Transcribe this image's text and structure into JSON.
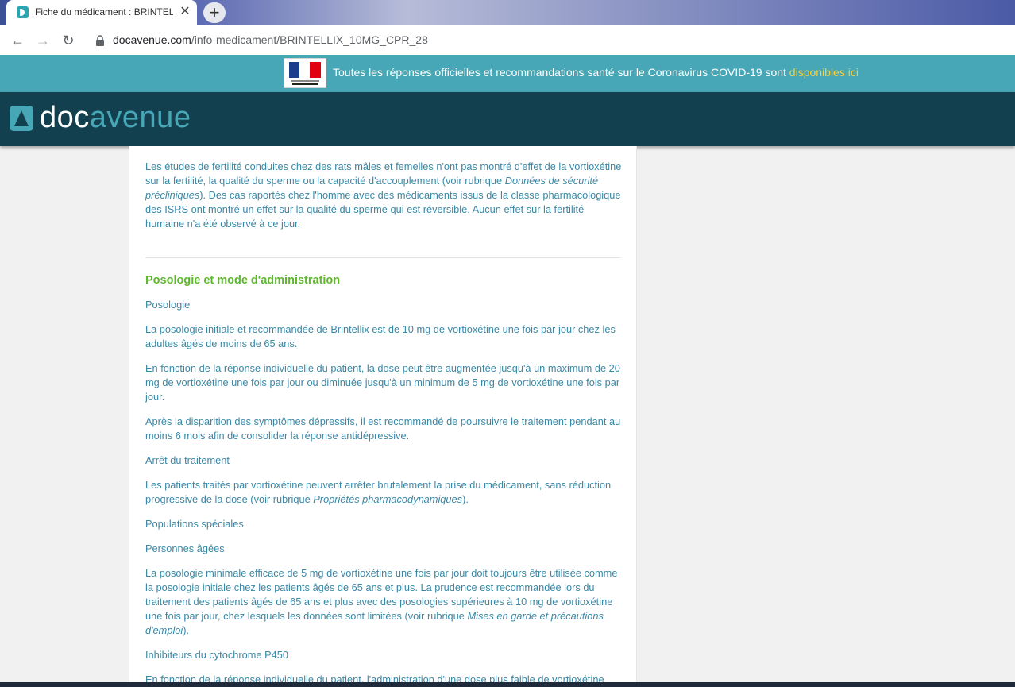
{
  "browser": {
    "tab_title": "Fiche du médicament : BRINTELLIX",
    "tab_close_glyph": "✕",
    "new_tab_glyph": "+",
    "back_glyph": "←",
    "forward_glyph": "→",
    "reload_glyph": "↻",
    "url_host": "docavenue.com",
    "url_path": "/info-medicament/BRINTELLIX_10MG_CPR_28"
  },
  "banner": {
    "text": "Toutes les réponses officielles et recommandations santé sur le Coronavirus COVID-19 sont ",
    "link": "disponibles ici",
    "text_color": "#ffffff",
    "link_color": "#f4d03f",
    "background": "#48a7b6"
  },
  "site": {
    "logo_part1": "doc",
    "logo_part2": "avenue",
    "header_background": "#12404e"
  },
  "content": {
    "fertility_1": "Les études de fertilité conduites chez des rats mâles et femelles n'ont pas montré d'effet de la vortioxétine sur la fertilité, la qualité du sperme ou la capacité d'accouplement (voir rubrique ",
    "fertility_em": "Données de sécurité précliniques",
    "fertility_2": "). Des cas raportés chez l'homme avec des médicaments issus de la classe pharmacologique des ISRS ont montré un effet sur la qualité du sperme qui est réversible. Aucun effet sur la fertilité humaine n'a été observé à ce jour.",
    "section_title": "Posologie et mode d'administration",
    "posologie_label": "Posologie",
    "p1": "La posologie initiale et recommandée de Brintellix est de 10 mg de vortioxétine une fois par jour chez les adultes âgés de moins de 65 ans.",
    "p2": "En fonction de la réponse individuelle du patient, la dose peut être augmentée jusqu'à un maximum de 20 mg de vortioxétine une fois par jour ou diminuée jusqu'à un minimum de 5 mg de vortioxétine une fois par jour.",
    "p3": "Après la disparition des symptômes dépressifs, il est recommandé de poursuivre le traitement pendant au moins 6 mois afin de consolider la réponse antidépressive.",
    "arret_label": "Arrêt du traitement",
    "p4_1": "Les patients traités par vortioxétine peuvent arrêter brutalement la prise du médicament, sans réduction progressive de la dose (voir rubrique ",
    "p4_em": "Propriétés pharmacodynamiques",
    "p4_2": ").",
    "populations_label": "Populations spéciales",
    "agees_label": "Personnes âgées",
    "p5_1": "La posologie minimale efficace de 5 mg de vortioxétine une fois par jour doit toujours être utilisée comme la posologie initiale chez les patients âgés de 65 ans et plus. La prudence est recommandée lors du traitement des patients âgés de 65 ans et plus avec des posologies supérieures à 10 mg de vortioxétine une fois par jour, chez lesquels les données sont limitées (voir rubrique ",
    "p5_em": "Mises en garde et précautions d'emploi",
    "p5_2": ").",
    "inhibiteurs_label": "Inhibiteurs du cytochrome P450",
    "p6": "En fonction de la réponse individuelle du patient, l'administration d'une dose plus faible de vortioxétine",
    "text_color": "#3a88a6",
    "title_color": "#5db82c"
  }
}
